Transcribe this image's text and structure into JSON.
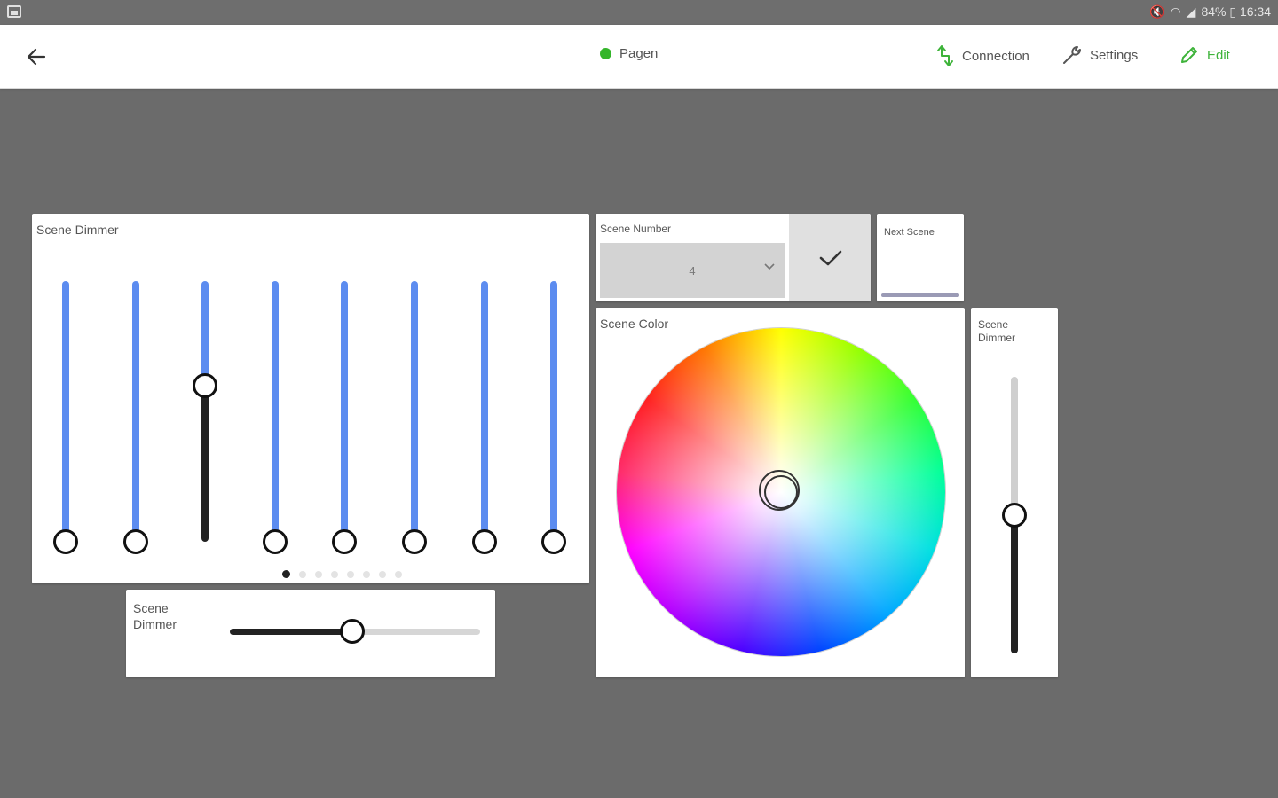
{
  "statusbar": {
    "status_text": "84% ▯ 16:34"
  },
  "appbar": {
    "page_name": "Pagen",
    "actions": {
      "connection": "Connection",
      "settings": "Settings",
      "edit": "Edit"
    },
    "colors": {
      "status_dot": "#34b52a",
      "edit": "#3eb33a"
    }
  },
  "scene_dimmer_multi": {
    "title": "Scene Dimmer",
    "sliders": [
      {
        "value": 0
      },
      {
        "value": 0
      },
      {
        "value": 0.6
      },
      {
        "value": 0
      },
      {
        "value": 0
      },
      {
        "value": 0
      },
      {
        "value": 0
      },
      {
        "value": 0
      }
    ],
    "pages": 8,
    "current_page": 1
  },
  "scene_dimmer_horizontal": {
    "title_line1": "Scene",
    "title_line2": "Dimmer",
    "value": 0.49
  },
  "scene_number": {
    "title": "Scene Number",
    "selected": "4"
  },
  "next_scene": {
    "title": "Next Scene"
  },
  "scene_color": {
    "title": "Scene Color"
  },
  "scene_dimmer_vertical": {
    "title_line1": "Scene",
    "title_line2": "Dimmer",
    "value": 0.5
  },
  "colors": {
    "accent_track": "#5c8cf0",
    "dark_track": "#222222",
    "background": "#6b6b6b"
  }
}
